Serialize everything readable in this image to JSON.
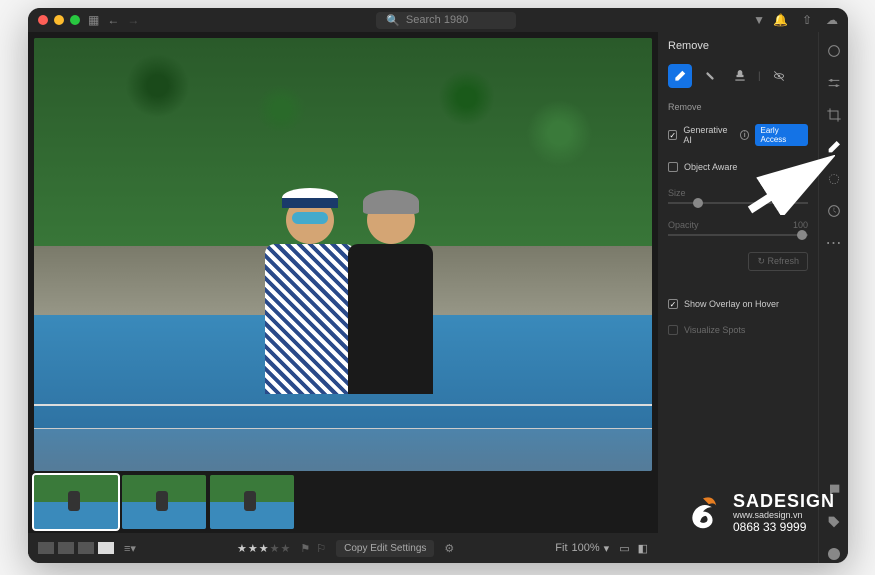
{
  "titlebar": {
    "search_placeholder": "Search 1980"
  },
  "panel": {
    "title": "Remove",
    "subhead": "Remove",
    "generative_label": "Generative AI",
    "badge": "Early Access",
    "object_aware_label": "Object Aware",
    "size_label": "Size",
    "opacity_label": "Opacity",
    "opacity_value": "100",
    "refresh_label": "Refresh",
    "overlay_label": "Show Overlay on Hover",
    "visualize_label": "Visualize Spots"
  },
  "bottom": {
    "copy_label": "Copy Edit Settings",
    "fit_label": "Fit",
    "zoom_value": "100%"
  },
  "watermark": {
    "brand": "SADESIGN",
    "url": "www.sadesign.vn",
    "phone": "0868 33 9999"
  }
}
